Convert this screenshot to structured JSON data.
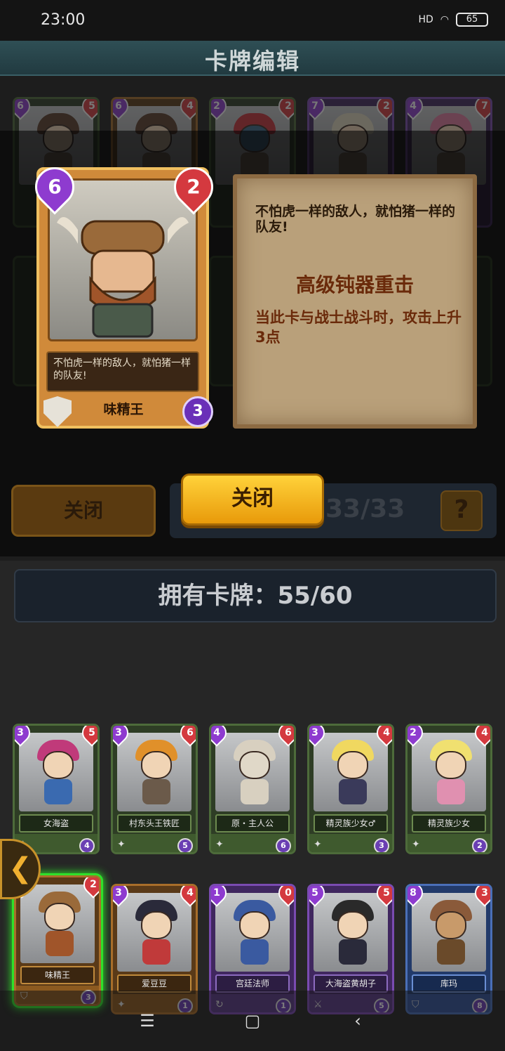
{
  "status": {
    "time": "23:00",
    "signal": "HD",
    "battery": "65"
  },
  "title": "卡牌编辑",
  "deck_cards_row1": [
    {
      "cost": "6",
      "atk": "5"
    },
    {
      "cost": "6",
      "atk": "4"
    },
    {
      "cost": "2",
      "atk": "2"
    },
    {
      "cost": "7",
      "atk": "2"
    },
    {
      "cost": "4",
      "atk": "7"
    }
  ],
  "detail": {
    "cost": "6",
    "attack": "2",
    "quote": "不怕虎一样的敌人，就怕猪一样的队友!",
    "name": "味精王",
    "level": "3",
    "skill_name": "高级钝器重击",
    "skill_desc": "当此卡与战士战斗时，攻击上升3点"
  },
  "close_label": "关闭",
  "deck_count": "33/33",
  "help_label": "?",
  "owned": "拥有卡牌：55/60",
  "owned_cards_row1": [
    {
      "name": "女海盗",
      "cost": "3",
      "atk": "5",
      "level": "4"
    },
    {
      "name": "村东头王铁匠",
      "cost": "3",
      "atk": "6",
      "level": "5"
    },
    {
      "name": "原・主人公",
      "cost": "4",
      "atk": "6",
      "level": "6"
    },
    {
      "name": "精灵族少女♂",
      "cost": "3",
      "atk": "4",
      "level": "3"
    },
    {
      "name": "精灵族少女",
      "cost": "2",
      "atk": "4",
      "level": "2"
    }
  ],
  "owned_cards_row2": [
    {
      "name": "味精王",
      "cost": "6",
      "atk": "2",
      "level": "3"
    },
    {
      "name": "爱豆豆",
      "cost": "3",
      "atk": "4",
      "level": "1"
    },
    {
      "name": "宫廷法师",
      "cost": "1",
      "atk": "0",
      "level": "1"
    },
    {
      "name": "大海盗黄胡子",
      "cost": "5",
      "atk": "5",
      "level": "5"
    },
    {
      "name": "库玛",
      "cost": "8",
      "atk": "3",
      "level": "8"
    }
  ],
  "nav": {
    "menu": "☰",
    "home": "▢",
    "back": "‹"
  },
  "colors": {
    "accent": "#f5b51a",
    "selected": "#2fe02a"
  }
}
